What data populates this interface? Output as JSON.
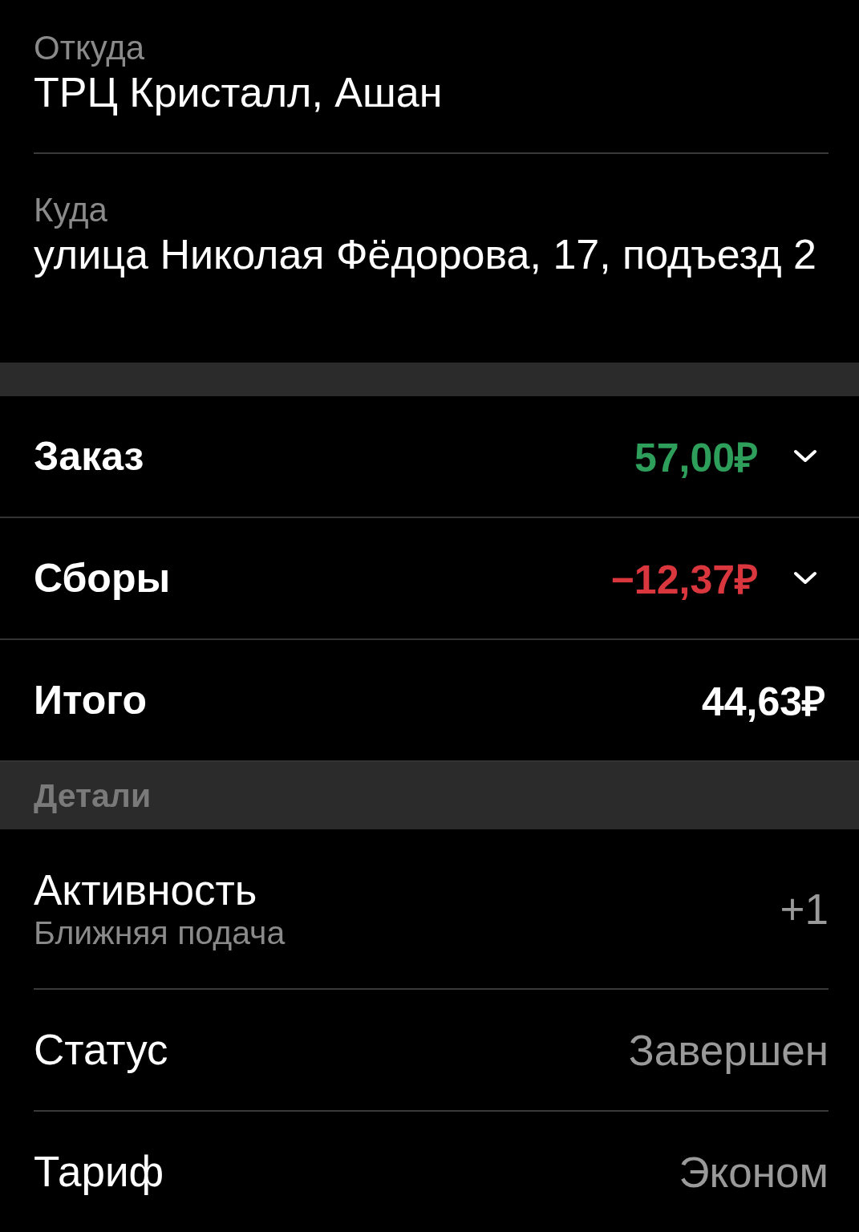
{
  "from": {
    "label": "Откуда",
    "value": "ТРЦ Кристалл, Ашан"
  },
  "to": {
    "label": "Куда",
    "value": "улица Николая Фёдорова, 17, подъезд 2"
  },
  "summary": [
    {
      "label": "Заказ",
      "amount": "57,00₽",
      "kind": "income",
      "expandable": true
    },
    {
      "label": "Сборы",
      "amount": "−12,37₽",
      "kind": "fee",
      "expandable": true
    },
    {
      "label": "Итого",
      "amount": "44,63₽",
      "kind": "total",
      "expandable": false
    }
  ],
  "details_header": "Детали",
  "details": [
    {
      "label": "Активность",
      "subtitle": "Ближняя подача",
      "value": "+1"
    },
    {
      "label": "Статус",
      "value": "Завершен"
    },
    {
      "label": "Тариф",
      "value": "Эконом"
    }
  ]
}
